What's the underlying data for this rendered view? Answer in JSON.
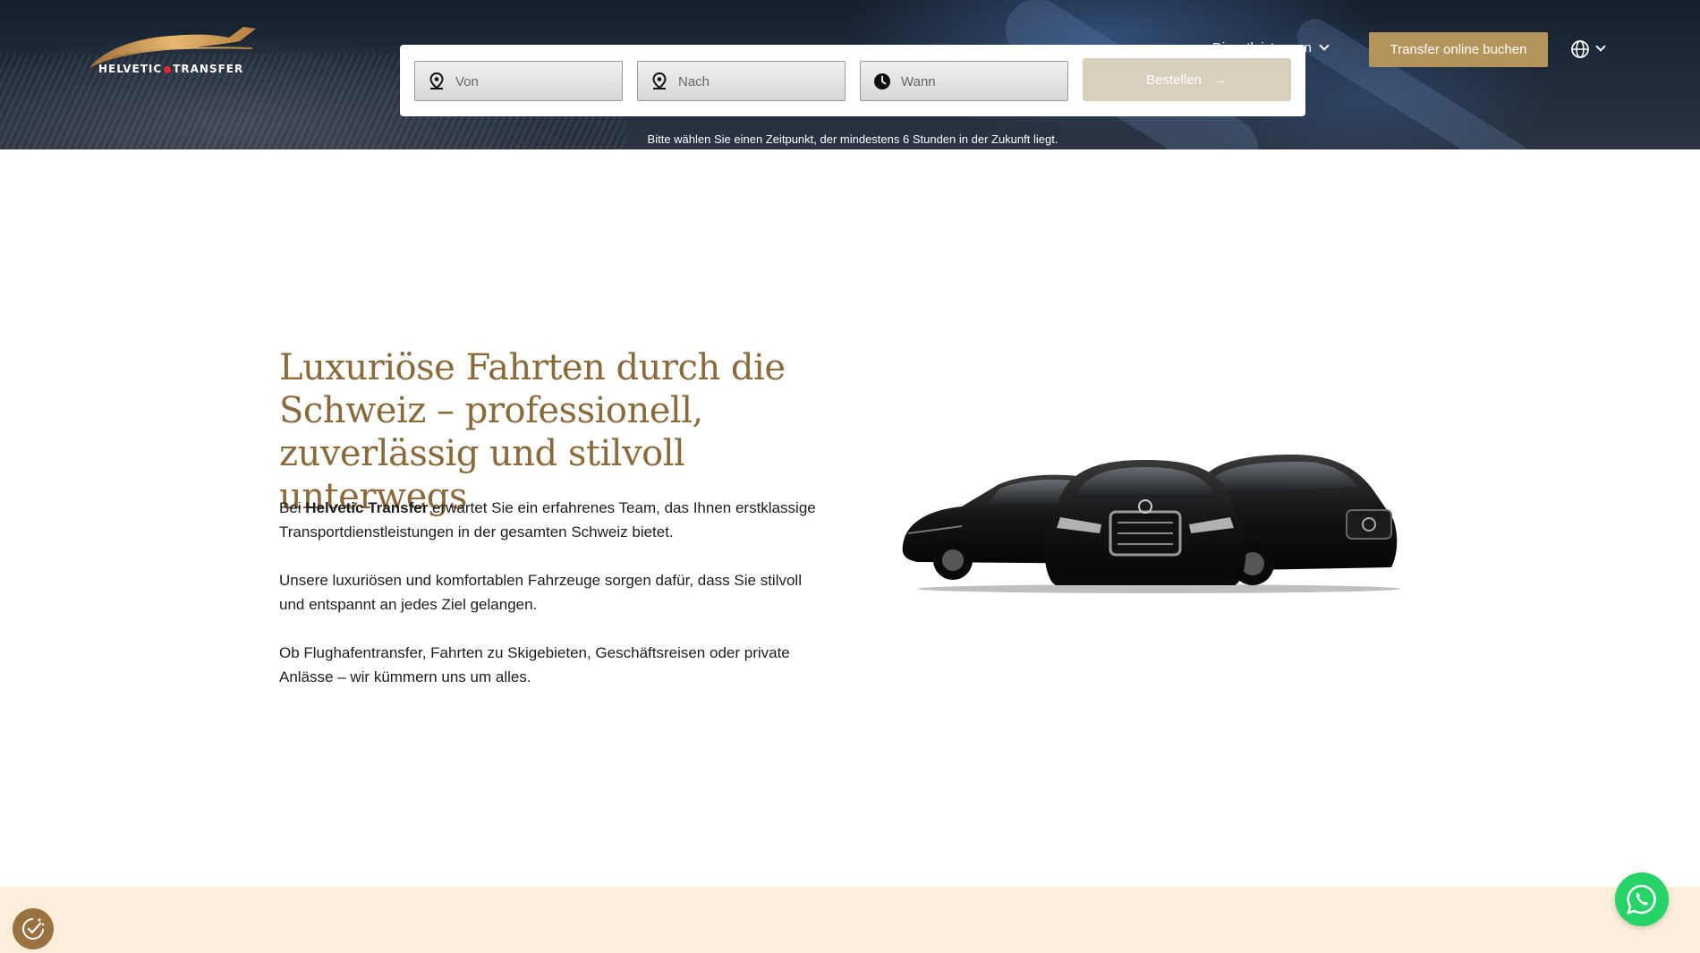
{
  "brand": {
    "logo_text_left": "HELVETIC",
    "logo_text_right": "TRANSFER",
    "gold": "#b4945a",
    "headline_color": "#8b6a3a"
  },
  "booking": {
    "from_placeholder": "Von",
    "to_placeholder": "Nach",
    "when_placeholder": "Wann",
    "order_label": "Bestellen",
    "hint": "Bitte wählen Sie einen Zeitpunkt, der mindestens 6 Stunden in der Zukunft liegt.",
    "from_icon": "map-pin-icon",
    "to_icon": "map-pin-icon",
    "when_icon": "clock-icon"
  },
  "nav": {
    "services_label": "Dienstleistungen",
    "cta_label": "Transfer online buchen",
    "language_icon": "globe-icon"
  },
  "main": {
    "headline": "Luxuriöse Fahrten durch die Schweiz – professionell, zuverlässig und stilvoll unterwegs",
    "p1_prefix": "Bei ",
    "p1_brand": "Helvetic Transfer",
    "p1_suffix": " erwartet Sie ein erfahrenes Team, das Ihnen erstklassige Transportdienstleistungen in der gesamten Schweiz bietet.",
    "p2": "Unsere luxuriösen und komfortablen Fahrzeuge sorgen dafür, dass Sie stilvoll und entspannt an jedes Ziel gelangen.",
    "p3": "Ob Flughafentransfer, Fahrten zu Skigebieten, Geschäftsreisen oder private Anlässe – wir kümmern uns um alles."
  },
  "floating": {
    "cookie_icon": "cookie-settings-icon",
    "whatsapp_icon": "whatsapp-icon",
    "whatsapp_color": "#25d366"
  }
}
